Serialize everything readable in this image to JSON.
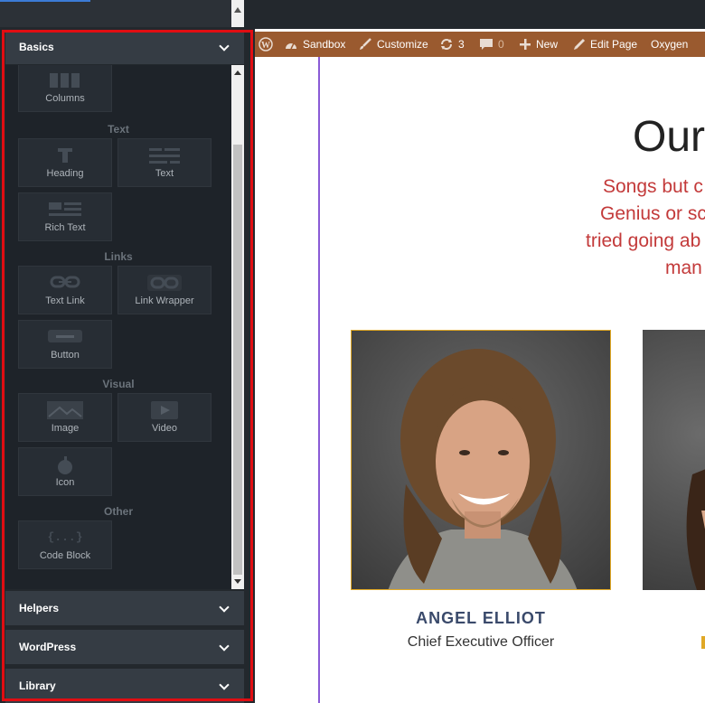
{
  "panel": {
    "sections": {
      "basics": "Basics",
      "helpers": "Helpers",
      "wordpress": "WordPress",
      "library": "Library"
    },
    "categories": {
      "text": "Text",
      "links": "Links",
      "visual": "Visual",
      "other": "Other"
    },
    "tiles": {
      "columns": "Columns",
      "heading": "Heading",
      "text": "Text",
      "rich_text": "Rich Text",
      "text_link": "Text Link",
      "link_wrapper": "Link Wrapper",
      "button": "Button",
      "image": "Image",
      "video": "Video",
      "icon": "Icon",
      "code_block": "Code Block"
    },
    "code_icon_glyph": "{...}"
  },
  "adminbar": {
    "site": "Sandbox",
    "customize": "Customize",
    "updates": "3",
    "comments": "0",
    "new": "New",
    "edit_page": "Edit Page",
    "oxygen": "Oxygen"
  },
  "page": {
    "title": "Our",
    "subtitle_lines": [
      "Songs but c",
      "Genius or sc",
      "tried going ab",
      "man"
    ],
    "members": [
      {
        "name": "ANGEL ELLIOT",
        "role": "Chief Executive Officer"
      }
    ]
  },
  "colors": {
    "panel_bg": "#23282d",
    "admin_bar_brown": "#9a5a2f",
    "subtitle_red": "#c33a3a",
    "highlight_red": "#e10d12"
  }
}
